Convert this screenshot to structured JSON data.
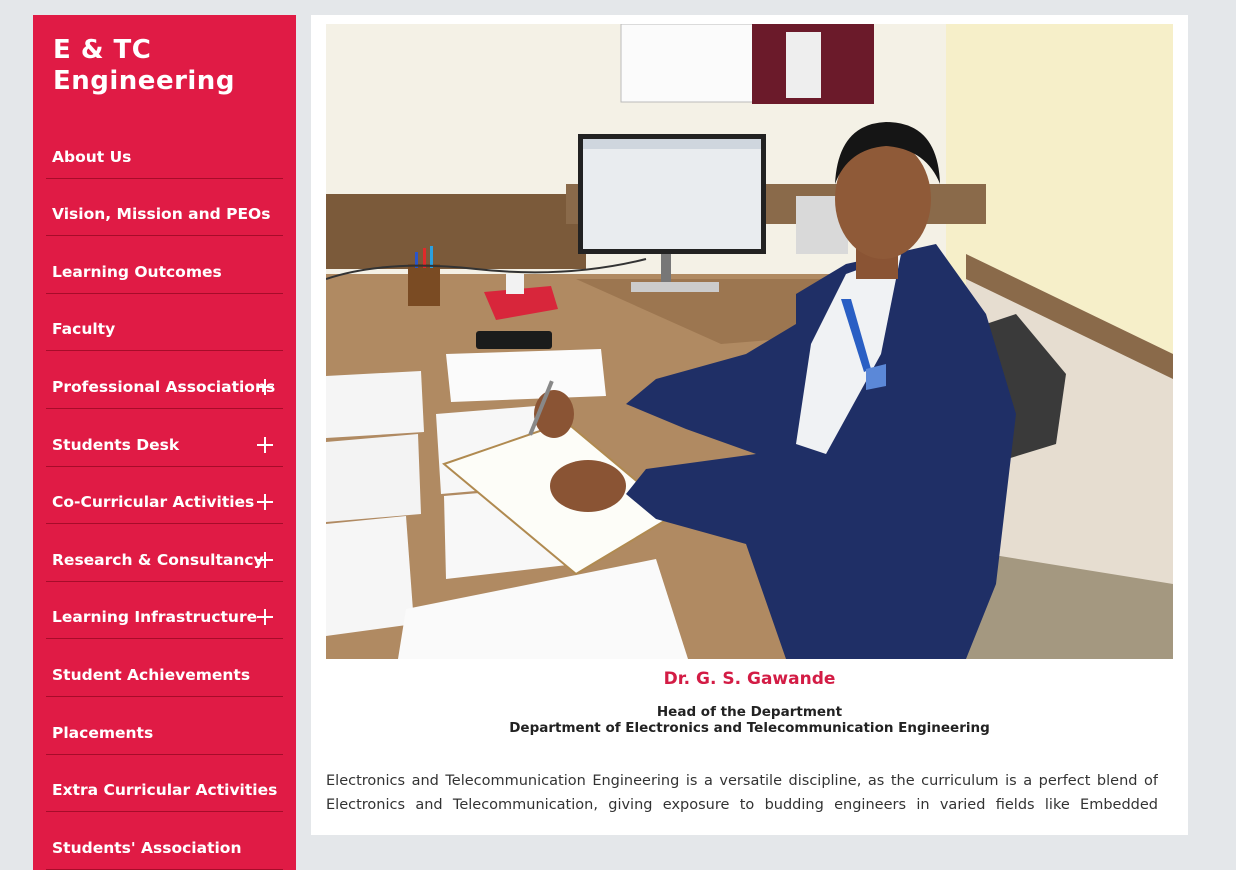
{
  "sidebar": {
    "title": "E & TC\nEngineering",
    "accent_color": "#e01b45",
    "items": [
      {
        "label": "About Us",
        "expandable": false
      },
      {
        "label": "Vision, Mission and PEOs",
        "expandable": false
      },
      {
        "label": "Learning Outcomes",
        "expandable": false
      },
      {
        "label": "Faculty",
        "expandable": false
      },
      {
        "label": "Professional Associations",
        "expandable": true
      },
      {
        "label": "Students Desk",
        "expandable": true
      },
      {
        "label": "Co-Curricular Activities",
        "expandable": true
      },
      {
        "label": "Research & Consultancy",
        "expandable": true
      },
      {
        "label": "Learning Infrastructure",
        "expandable": true
      },
      {
        "label": "Student Achievements",
        "expandable": false
      },
      {
        "label": "Placements",
        "expandable": false
      },
      {
        "label": "Extra Curricular Activities",
        "expandable": false
      },
      {
        "label": "Students' Association",
        "expandable": false
      }
    ]
  },
  "main": {
    "hod_name": "Dr. G. S. Gawande",
    "hod_role": "Head of the Department",
    "department": "Department of Electronics and Telecommunication Engineering",
    "intro_text": "Electronics and Telecommunication Engineering is a versatile discipline, as the curriculum is a perfect blend of Electronics and Telecommunication, giving exposure to budding engineers in varied fields like Embedded Systems,"
  }
}
